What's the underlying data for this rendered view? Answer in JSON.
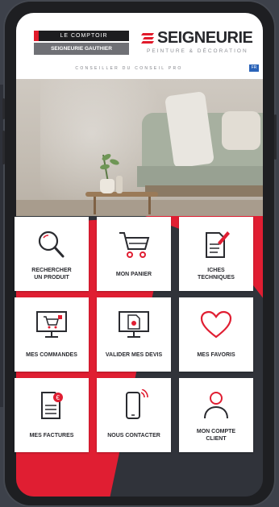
{
  "header": {
    "brand_left_top": "LE COMPTOIR",
    "brand_left_bottom": "SEIGNEURIE GAUTHIER",
    "brand_right_name": "SEIGNEURIE",
    "brand_right_sub": "PEINTURE & DÉCORATION",
    "tagline": "CONSEILLER DU CONSEIL PRO",
    "lang_badge": "FR"
  },
  "colors": {
    "accent": "#e01e32",
    "dark": "#30333a",
    "tile": "#ffffff",
    "text": "#2a2b30"
  },
  "tiles": [
    {
      "line1": "RECHERCHER",
      "line2": "UN PRODUIT",
      "icon": "search-icon"
    },
    {
      "line1": "MON PANIER",
      "line2": "",
      "icon": "cart-icon"
    },
    {
      "line1": "ICHES",
      "line2": "TECHNIQUES",
      "icon": "document-pen-icon"
    },
    {
      "line1": "MES COMMANDES",
      "line2": "",
      "icon": "monitor-cart-icon"
    },
    {
      "line1": "VALIDER MES DEVIS",
      "line2": "",
      "icon": "monitor-document-icon"
    },
    {
      "line1": "MES FAVORIS",
      "line2": "",
      "icon": "heart-icon"
    },
    {
      "line1": "MES FACTURES",
      "line2": "",
      "icon": "invoice-icon"
    },
    {
      "line1": "NOUS CONTACTER",
      "line2": "",
      "icon": "phone-ringing-icon"
    },
    {
      "line1": "MON COMPTE",
      "line2": "CLIENT",
      "icon": "user-icon"
    }
  ]
}
